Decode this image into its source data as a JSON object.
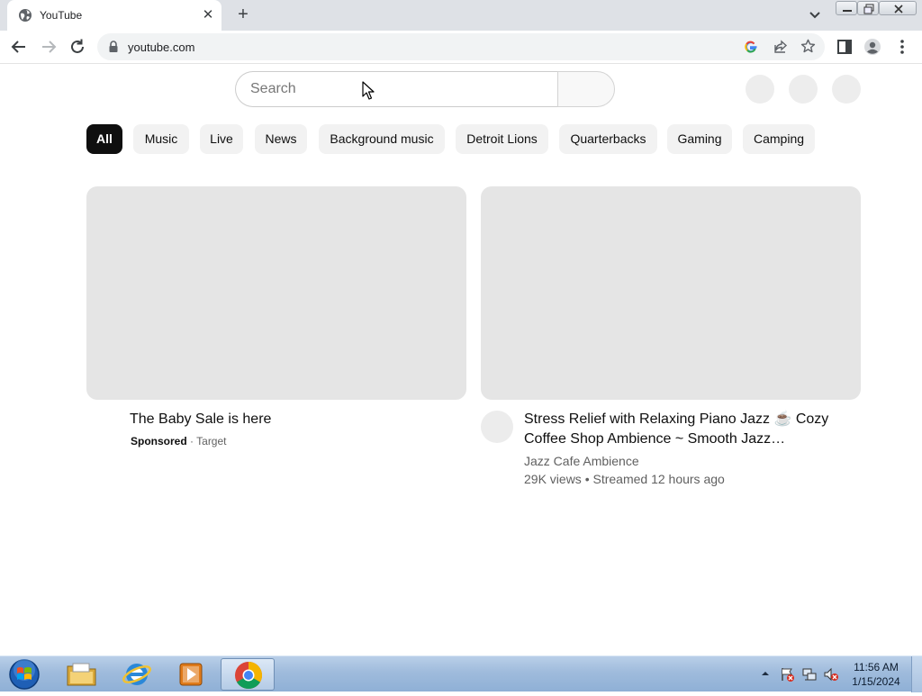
{
  "browser": {
    "tab_title": "YouTube",
    "url": "youtube.com"
  },
  "youtube": {
    "search_placeholder": "Search",
    "chips": [
      "All",
      "Music",
      "Live",
      "News",
      "Background music",
      "Detroit Lions",
      "Quarterbacks",
      "Gaming",
      "Camping"
    ],
    "active_chip": "All",
    "videos": [
      {
        "title": "The Baby Sale is here",
        "sponsored_label": "Sponsored",
        "separator": "·",
        "advertiser": "Target"
      },
      {
        "title": "Stress Relief with Relaxing Piano Jazz ☕ Cozy Coffee Shop Ambience ~ Smooth Jazz…",
        "channel": "Jazz Cafe Ambience",
        "stats": "29K views • Streamed 12 hours ago"
      }
    ]
  },
  "taskbar": {
    "time": "11:56 AM",
    "date": "1/15/2024",
    "pinned": [
      "start-orb-icon",
      "file-explorer-icon",
      "internet-explorer-icon",
      "media-player-icon",
      "chrome-icon"
    ],
    "tray": [
      "show-hidden-icons-icon",
      "action-center-icon",
      "network-icon",
      "volume-muted-icon"
    ]
  }
}
